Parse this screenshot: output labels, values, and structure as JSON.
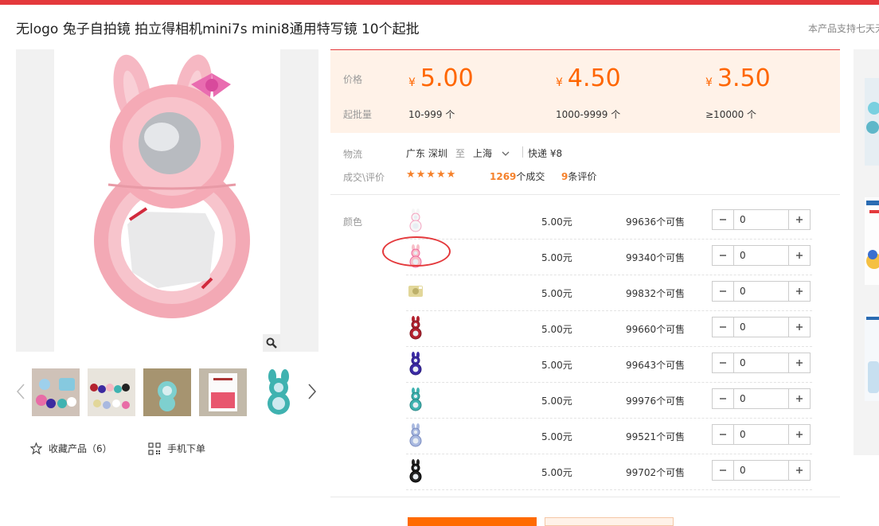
{
  "product": {
    "title": "无logo 兔子自拍镜 拍立得相机mini7s mini8通用特写镜 10个起批",
    "notice": "本产品支持七天无"
  },
  "price_box": {
    "price_label": "价格",
    "batch_label": "起批量",
    "currency": "¥",
    "tiers": [
      {
        "price": "5.00",
        "range": "10-999 个"
      },
      {
        "price": "4.50",
        "range": "1000-9999 个"
      },
      {
        "price": "3.50",
        "range": "≥10000 个"
      }
    ]
  },
  "logistics": {
    "label": "物流",
    "from": "广东 深圳",
    "to_word": "至",
    "to": "上海",
    "shipping": "快递 ¥8"
  },
  "deals": {
    "label": "成交\\评价",
    "stars": "★★★★★",
    "deals_count": "1269",
    "deals_suffix": "个成交",
    "reviews_count": "9",
    "reviews_suffix": "条评价"
  },
  "sku": {
    "color_label": "颜色",
    "rows": [
      {
        "price": "5.00元",
        "stock": "99636个可售",
        "qty": "0",
        "color": "#f6f6f6",
        "accent": "#f4a3c0"
      },
      {
        "price": "5.00元",
        "stock": "99340个可售",
        "qty": "0",
        "color": "#f7bfc8",
        "accent": "#f06aa0"
      },
      {
        "price": "5.00元",
        "stock": "99832个可售",
        "qty": "0",
        "color": "#e2d79a",
        "accent": "#bdb06a"
      },
      {
        "price": "5.00元",
        "stock": "99660个可售",
        "qty": "0",
        "color": "#b3222f",
        "accent": "#7e1520"
      },
      {
        "price": "5.00元",
        "stock": "99643个可售",
        "qty": "0",
        "color": "#3b2ba5",
        "accent": "#2a1c7c"
      },
      {
        "price": "5.00元",
        "stock": "99976个可售",
        "qty": "0",
        "color": "#3fb2b0",
        "accent": "#288684"
      },
      {
        "price": "5.00元",
        "stock": "99521个可售",
        "qty": "0",
        "color": "#a9b9e0",
        "accent": "#7a8cc0"
      },
      {
        "price": "5.00元",
        "stock": "99702个可售",
        "qty": "0",
        "color": "#222222",
        "accent": "#000000"
      }
    ]
  },
  "actions": {
    "favorite": "收藏产品（6）",
    "mobile": "手机下单"
  },
  "colors": {
    "brand_red": "#e4393c",
    "price_orange": "#ff6600",
    "price_box_bg": "#fff2e8"
  }
}
